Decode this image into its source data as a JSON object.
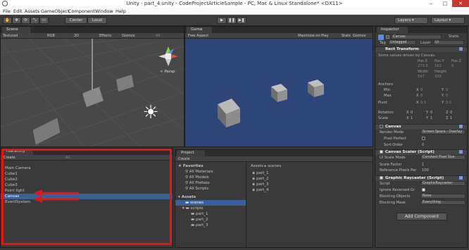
{
  "window": {
    "title": "Unity - part_4.unity - CodeProjectArticleSample - PC, Mac & Linux Standalone* <DX11>",
    "controls": {
      "minimize": "–",
      "maximize": "□",
      "close": "✕"
    }
  },
  "menu": [
    "File",
    "Edit",
    "Assets",
    "GameObject",
    "Component",
    "Window",
    "Help"
  ],
  "toolbar": {
    "center": "Center",
    "local": "Local",
    "layers": "Layers",
    "layout": "Layout"
  },
  "scene": {
    "tab": "Scene",
    "shading": "Textured",
    "rgb": "RGB",
    "mode2d": "2D",
    "effects": "Effects",
    "gizmos": "Gizmos",
    "search": "All",
    "persp": "< Persp"
  },
  "game": {
    "tab": "Game",
    "aspect": "Free Aspect",
    "maximize": "Maximize on Play",
    "stats": "Stats",
    "gizmos": "Gizmos",
    "background": "#2e4578"
  },
  "hierarchy": {
    "tab": "Hierarchy",
    "create": "Create",
    "search": "All",
    "items": [
      "Main Camera",
      "Cube1",
      "Cube2",
      "Cube3",
      "Point light",
      "Canvas",
      "EventSystem"
    ],
    "selected": "Canvas"
  },
  "project": {
    "tab": "Project",
    "create": "Create",
    "favorites": "Favorites",
    "fav_items": [
      "All Materials",
      "All Models",
      "All Prefabs",
      "All Scripts"
    ],
    "assets": "Assets",
    "tree": [
      {
        "label": "scenes",
        "level": 1,
        "selected": true
      },
      {
        "label": "scripts",
        "level": 1
      },
      {
        "label": "part_1",
        "level": 2
      },
      {
        "label": "part_2",
        "level": 2
      },
      {
        "label": "part_3",
        "level": 2
      }
    ],
    "breadcrumb": [
      "Assets",
      "scenes"
    ],
    "files": [
      "part_1",
      "part_2",
      "part_3",
      "part_4"
    ]
  },
  "inspector": {
    "tab": "Inspector",
    "object_name": "Canvas",
    "static": "Static",
    "tag_label": "Tag",
    "tag_value": "Untagged",
    "layer_label": "Layer",
    "layer_value": "UI",
    "rect_transform": {
      "title": "Rect Transform",
      "note": "Some values driven by Canvas.",
      "pos_headers": [
        "Pos X",
        "Pos Y",
        "Pos Z"
      ],
      "pos_values": [
        "273.5",
        "163",
        "0"
      ],
      "size_headers": [
        "Width",
        "Height"
      ],
      "size_values": [
        "547",
        "326"
      ],
      "anchors": "Anchors",
      "min_label": "Min",
      "min_x": "0",
      "min_y": "0",
      "max_label": "Max",
      "max_x": "0",
      "max_y": "0",
      "pivot_label": "Pivot",
      "pivot_x": "0.5",
      "pivot_y": "0.5",
      "rotation_label": "Rotation",
      "rot_x": "0",
      "rot_y": "0",
      "rot_z": "0",
      "scale_label": "Scale",
      "scale_x": "1",
      "scale_y": "1",
      "scale_z": "1",
      "x": "X",
      "y": "Y",
      "z": "Z"
    },
    "canvas": {
      "title": "Canvas",
      "render_mode_label": "Render Mode",
      "render_mode_value": "Screen Space - Overlay",
      "pixel_perfect": "Pixel Perfect",
      "sort_order_label": "Sort Order",
      "sort_order_value": "0"
    },
    "scaler": {
      "title": "Canvas Scaler (Script)",
      "ui_scale_label": "Ui Scale Mode",
      "ui_scale_value": "Constant Pixel Size",
      "scale_factor_label": "Scale Factor",
      "scale_factor_value": "1",
      "ref_ppu_label": "Reference Pixels Per",
      "ref_ppu_value": "100"
    },
    "raycaster": {
      "title": "Graphic Raycaster (Script)",
      "script_label": "Script",
      "script_value": "GraphicRaycaster",
      "ignore_label": "Ignore Reversed Gr",
      "blocking_objects_label": "Blocking Objects",
      "blocking_objects_value": "None",
      "blocking_mask_label": "Blocking Mask",
      "blocking_mask_value": "Everything"
    },
    "add_component": "Add Component"
  },
  "colors": {
    "accent_selection": "#3d5f97",
    "highlight_box": "#e11111",
    "arrow": "#e11111"
  }
}
